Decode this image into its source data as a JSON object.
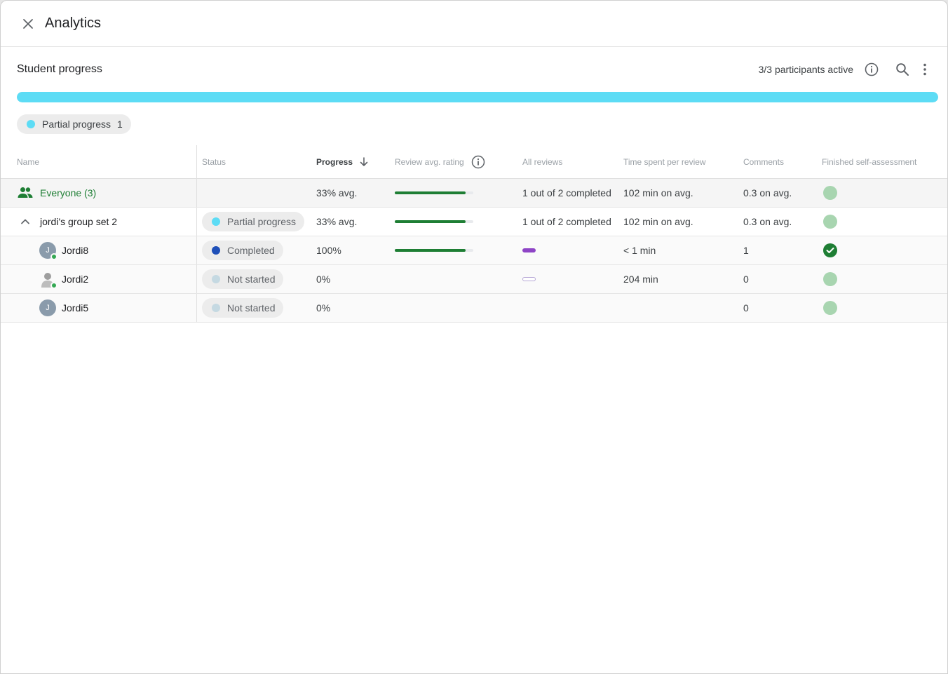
{
  "window": {
    "title": "Analytics"
  },
  "section": {
    "title": "Student progress",
    "participants": "3/3 participants active"
  },
  "overall_progress": {
    "fraction": 1.0,
    "color": "#5ddcf5"
  },
  "filter_chip": {
    "label": "Partial progress",
    "count": "1",
    "dot_color": "#5ddcf5"
  },
  "table": {
    "columns": {
      "name": "Name",
      "status": "Status",
      "progress": "Progress",
      "rating": "Review avg. rating",
      "reviews": "All reviews",
      "time": "Time spent per review",
      "comments": "Comments",
      "finished": "Finished self-assessment"
    },
    "everyone": {
      "label": "Everyone (3)",
      "progress": "33% avg.",
      "rating_fraction": 0.9,
      "reviews": "1 out of 2 completed",
      "time": "102 min on avg.",
      "comments": "0.3 on avg.",
      "finished": false
    },
    "group": {
      "label": "jordi's group set 2",
      "status": "Partial progress",
      "status_color": "#5ddcf5",
      "progress": "33% avg.",
      "rating_fraction": 0.9,
      "reviews": "1 out of 2 completed",
      "time": "102 min on avg.",
      "comments": "0.3 on avg.",
      "finished": false
    },
    "students": [
      {
        "name": "Jordi8",
        "avatar_letter": "J",
        "online": true,
        "status": "Completed",
        "status_color": "#1e4fb8",
        "progress": "100%",
        "rating_fraction": 0.9,
        "review": "done",
        "time": "< 1 min",
        "comments": "1",
        "finished": true
      },
      {
        "name": "Jordi2",
        "avatar_letter": "",
        "online": true,
        "status": "Not started",
        "status_color": "#c5d9e2",
        "progress": "0%",
        "review": "pending",
        "time": "204 min",
        "comments": "0",
        "finished": false
      },
      {
        "name": "Jordi5",
        "avatar_letter": "J",
        "online": false,
        "status": "Not started",
        "status_color": "#c5d9e2",
        "progress": "0%",
        "review": "none",
        "time": "",
        "comments": "0",
        "finished": false
      }
    ]
  }
}
